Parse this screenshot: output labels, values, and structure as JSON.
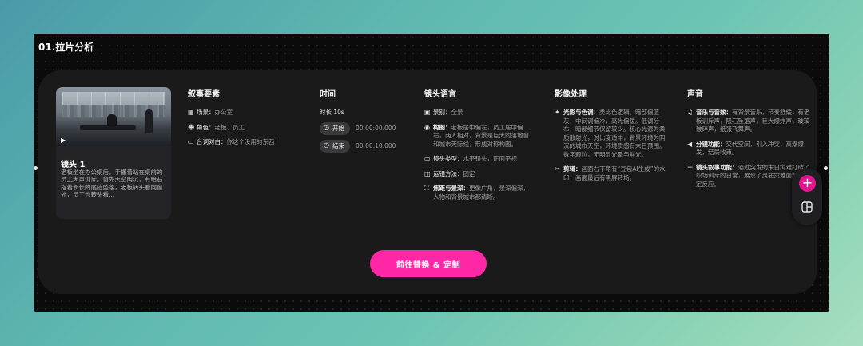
{
  "frame": {
    "title": "01.拉片分析"
  },
  "shot_card": {
    "title": "镜头 1",
    "play_icon": "play-icon",
    "description": "老板坐在办公桌后，手握着站在桌前的员工大声训斥，窗外天空阴沉，有暗石指着长长的尾迹坠落，老板转头看向窗外，员工也转头看..."
  },
  "narrative": {
    "heading": "叙事要素",
    "items": [
      {
        "label": "场景：",
        "value": "办公室",
        "icon": "building-icon"
      },
      {
        "label": "角色：",
        "value": "老板、员工",
        "icon": "face-icon"
      },
      {
        "label": "台词对白：",
        "value": "你这个没用的东西！",
        "icon": "chat-icon"
      }
    ]
  },
  "time": {
    "heading": "时间",
    "duration": "时长 10s",
    "start_label": "开始",
    "start_value": "00:00:00.000",
    "end_label": "结束",
    "end_value": "00:00:10.000"
  },
  "lens": {
    "heading": "镜头语言",
    "items": [
      {
        "label": "景别：",
        "value": "全景",
        "icon": "frame-icon"
      },
      {
        "label": "构图：",
        "value": "老板居中偏左，员工居中偏右，两人相对，背景是巨大的落地窗和城市天际线，形成对称构图。",
        "icon": "composition-icon"
      },
      {
        "label": "镜头类型：",
        "value": "水平镜头，正面平视",
        "icon": "camera-icon"
      },
      {
        "label": "运镜方法：",
        "value": "固定",
        "icon": "movement-icon"
      },
      {
        "label": "焦距与景深：",
        "value": "更像广角，景深偏深，人物和背景城市都清晰。",
        "icon": "focus-icon"
      }
    ]
  },
  "image": {
    "heading": "影像处理",
    "items": [
      {
        "label": "光影与色调：",
        "value": "类比色逻辑。暗部偏蓝灰，中间调偏冷，高光偏暖。低调分布，暗部细节保留较少。核心光源为柔质散射光，对比度适中，背景环境为阴沉的城市天空，环境质感有末日预围。数字颗粒，无明显光晕与鲜光。",
        "icon": "sparkle-icon"
      },
      {
        "label": "剪辑：",
        "value": "画面右下角有“豆包AI生成”的水印，画面最后有黑屏转场。",
        "icon": "scissors-icon"
      }
    ]
  },
  "sound": {
    "heading": "声音",
    "items": [
      {
        "label": "音乐与音效：",
        "value": "有背景音乐，节奏舒缓，有老板训斥声，陨石坠落声，巨大爆炸声，玻璃破碎声，纸张飞舞声。",
        "icon": "music-icon"
      },
      {
        "label": "分镜功能：",
        "value": "交代空间，引入冲突，高潮爆发，结局收束。",
        "icon": "speaker-icon"
      },
      {
        "label": "镜头叙事功能：",
        "value": "通过突发的末日灾难打破了职场训斥的日常，展现了灵在灾难面前的淡定反应。",
        "icon": "list-icon"
      }
    ]
  },
  "cta": {
    "label": "前往替换 & 定制"
  },
  "toolbar": {
    "add_icon": "plus-icon",
    "layout_icon": "layout-icon"
  }
}
